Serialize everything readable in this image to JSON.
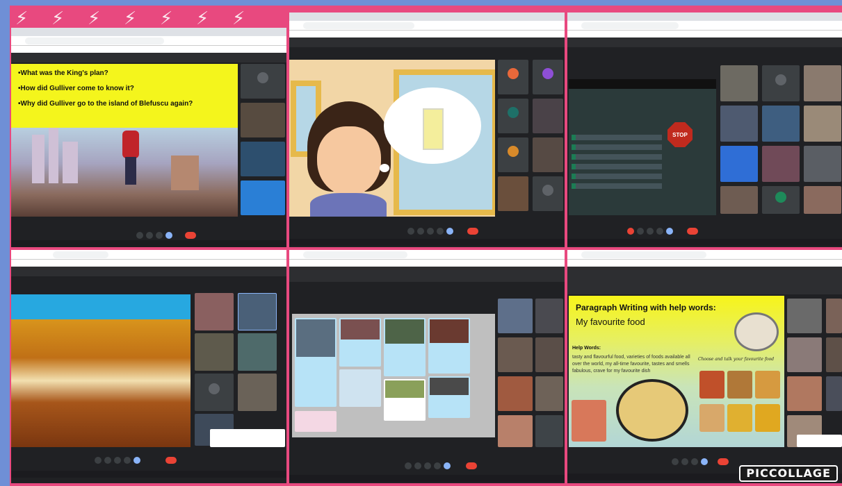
{
  "collage": {
    "background_color": "#6f8fd6",
    "border_color": "#e8497f",
    "logo_text": "PICCOLLAGE"
  },
  "panel1": {
    "questions": [
      "•What was the King's plan?",
      "•How did Gulliver come to know it?",
      "•Why did Gulliver go to the island of Blefuscu again?"
    ]
  },
  "panel3": {
    "stop_sign_text": "STOP"
  },
  "panel6": {
    "title_line1": "Paragraph Writing with help words:",
    "title_line2": "My favourite food",
    "help_label": "Help Words:",
    "help_text": "tasty and flavourful food, varieties of foods available all over the world, my all-time favourite, tastes and smells fabulous, crave for my favourite dish",
    "cursive_caption": "Choose and talk your favourite food"
  }
}
